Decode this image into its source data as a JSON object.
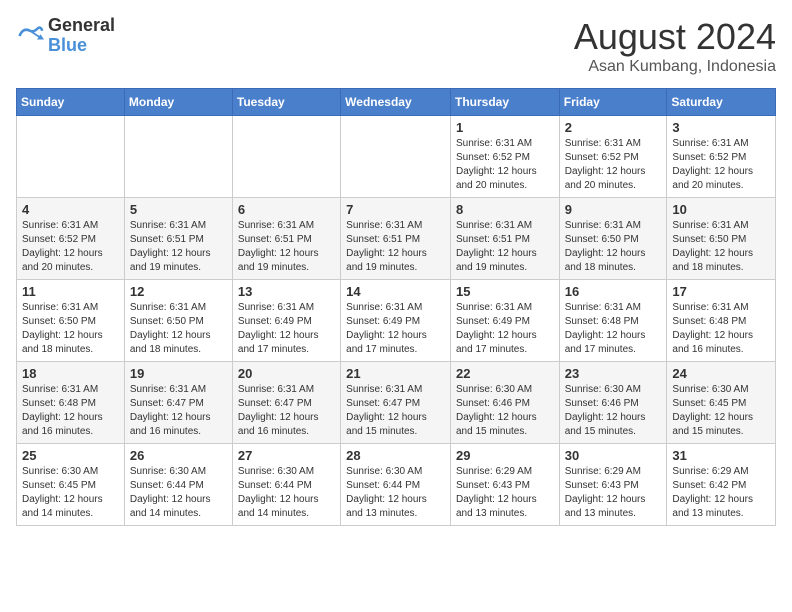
{
  "header": {
    "logo_general": "General",
    "logo_blue": "Blue",
    "month_year": "August 2024",
    "location": "Asan Kumbang, Indonesia"
  },
  "days_of_week": [
    "Sunday",
    "Monday",
    "Tuesday",
    "Wednesday",
    "Thursday",
    "Friday",
    "Saturday"
  ],
  "weeks": [
    [
      {
        "day": "",
        "info": ""
      },
      {
        "day": "",
        "info": ""
      },
      {
        "day": "",
        "info": ""
      },
      {
        "day": "",
        "info": ""
      },
      {
        "day": "1",
        "info": "Sunrise: 6:31 AM\nSunset: 6:52 PM\nDaylight: 12 hours\nand 20 minutes."
      },
      {
        "day": "2",
        "info": "Sunrise: 6:31 AM\nSunset: 6:52 PM\nDaylight: 12 hours\nand 20 minutes."
      },
      {
        "day": "3",
        "info": "Sunrise: 6:31 AM\nSunset: 6:52 PM\nDaylight: 12 hours\nand 20 minutes."
      }
    ],
    [
      {
        "day": "4",
        "info": "Sunrise: 6:31 AM\nSunset: 6:52 PM\nDaylight: 12 hours\nand 20 minutes."
      },
      {
        "day": "5",
        "info": "Sunrise: 6:31 AM\nSunset: 6:51 PM\nDaylight: 12 hours\nand 19 minutes."
      },
      {
        "day": "6",
        "info": "Sunrise: 6:31 AM\nSunset: 6:51 PM\nDaylight: 12 hours\nand 19 minutes."
      },
      {
        "day": "7",
        "info": "Sunrise: 6:31 AM\nSunset: 6:51 PM\nDaylight: 12 hours\nand 19 minutes."
      },
      {
        "day": "8",
        "info": "Sunrise: 6:31 AM\nSunset: 6:51 PM\nDaylight: 12 hours\nand 19 minutes."
      },
      {
        "day": "9",
        "info": "Sunrise: 6:31 AM\nSunset: 6:50 PM\nDaylight: 12 hours\nand 18 minutes."
      },
      {
        "day": "10",
        "info": "Sunrise: 6:31 AM\nSunset: 6:50 PM\nDaylight: 12 hours\nand 18 minutes."
      }
    ],
    [
      {
        "day": "11",
        "info": "Sunrise: 6:31 AM\nSunset: 6:50 PM\nDaylight: 12 hours\nand 18 minutes."
      },
      {
        "day": "12",
        "info": "Sunrise: 6:31 AM\nSunset: 6:50 PM\nDaylight: 12 hours\nand 18 minutes."
      },
      {
        "day": "13",
        "info": "Sunrise: 6:31 AM\nSunset: 6:49 PM\nDaylight: 12 hours\nand 17 minutes."
      },
      {
        "day": "14",
        "info": "Sunrise: 6:31 AM\nSunset: 6:49 PM\nDaylight: 12 hours\nand 17 minutes."
      },
      {
        "day": "15",
        "info": "Sunrise: 6:31 AM\nSunset: 6:49 PM\nDaylight: 12 hours\nand 17 minutes."
      },
      {
        "day": "16",
        "info": "Sunrise: 6:31 AM\nSunset: 6:48 PM\nDaylight: 12 hours\nand 17 minutes."
      },
      {
        "day": "17",
        "info": "Sunrise: 6:31 AM\nSunset: 6:48 PM\nDaylight: 12 hours\nand 16 minutes."
      }
    ],
    [
      {
        "day": "18",
        "info": "Sunrise: 6:31 AM\nSunset: 6:48 PM\nDaylight: 12 hours\nand 16 minutes."
      },
      {
        "day": "19",
        "info": "Sunrise: 6:31 AM\nSunset: 6:47 PM\nDaylight: 12 hours\nand 16 minutes."
      },
      {
        "day": "20",
        "info": "Sunrise: 6:31 AM\nSunset: 6:47 PM\nDaylight: 12 hours\nand 16 minutes."
      },
      {
        "day": "21",
        "info": "Sunrise: 6:31 AM\nSunset: 6:47 PM\nDaylight: 12 hours\nand 15 minutes."
      },
      {
        "day": "22",
        "info": "Sunrise: 6:30 AM\nSunset: 6:46 PM\nDaylight: 12 hours\nand 15 minutes."
      },
      {
        "day": "23",
        "info": "Sunrise: 6:30 AM\nSunset: 6:46 PM\nDaylight: 12 hours\nand 15 minutes."
      },
      {
        "day": "24",
        "info": "Sunrise: 6:30 AM\nSunset: 6:45 PM\nDaylight: 12 hours\nand 15 minutes."
      }
    ],
    [
      {
        "day": "25",
        "info": "Sunrise: 6:30 AM\nSunset: 6:45 PM\nDaylight: 12 hours\nand 14 minutes."
      },
      {
        "day": "26",
        "info": "Sunrise: 6:30 AM\nSunset: 6:44 PM\nDaylight: 12 hours\nand 14 minutes."
      },
      {
        "day": "27",
        "info": "Sunrise: 6:30 AM\nSunset: 6:44 PM\nDaylight: 12 hours\nand 14 minutes."
      },
      {
        "day": "28",
        "info": "Sunrise: 6:30 AM\nSunset: 6:44 PM\nDaylight: 12 hours\nand 13 minutes."
      },
      {
        "day": "29",
        "info": "Sunrise: 6:29 AM\nSunset: 6:43 PM\nDaylight: 12 hours\nand 13 minutes."
      },
      {
        "day": "30",
        "info": "Sunrise: 6:29 AM\nSunset: 6:43 PM\nDaylight: 12 hours\nand 13 minutes."
      },
      {
        "day": "31",
        "info": "Sunrise: 6:29 AM\nSunset: 6:42 PM\nDaylight: 12 hours\nand 13 minutes."
      }
    ]
  ]
}
